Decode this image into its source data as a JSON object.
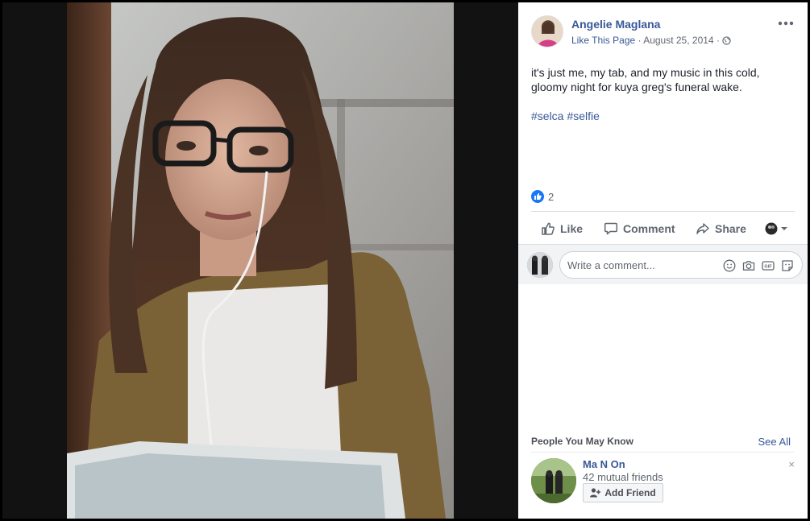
{
  "post": {
    "author": "Angelie Maglana",
    "like_page": "Like This Page",
    "separator": "·",
    "date": "August 25, 2014",
    "text": "it's just me, my tab, and my music in this cold, gloomy night for kuya greg's funeral wake.",
    "hashtags": [
      "#selca",
      "#selfie"
    ],
    "reaction_count": "2"
  },
  "actions": {
    "like": "Like",
    "comment": "Comment",
    "share": "Share"
  },
  "comment": {
    "placeholder": "Write a comment..."
  },
  "pymk": {
    "title": "People You May Know",
    "see_all": "See All",
    "person": {
      "name": "Ma N On",
      "mutual": "42 mutual friends",
      "add_friend": "Add Friend",
      "close": "×"
    }
  },
  "colors": {
    "link_blue": "#385898",
    "like_blue": "#1877f2",
    "text": "#1d2129",
    "muted": "#616770"
  },
  "icons": [
    "globe-icon",
    "more-options-icon",
    "like-icon",
    "comment-icon",
    "share-icon",
    "audience-selector-icon",
    "smiley-icon",
    "camera-icon",
    "gif-icon",
    "sticker-icon",
    "add-friend-icon",
    "close-icon"
  ]
}
